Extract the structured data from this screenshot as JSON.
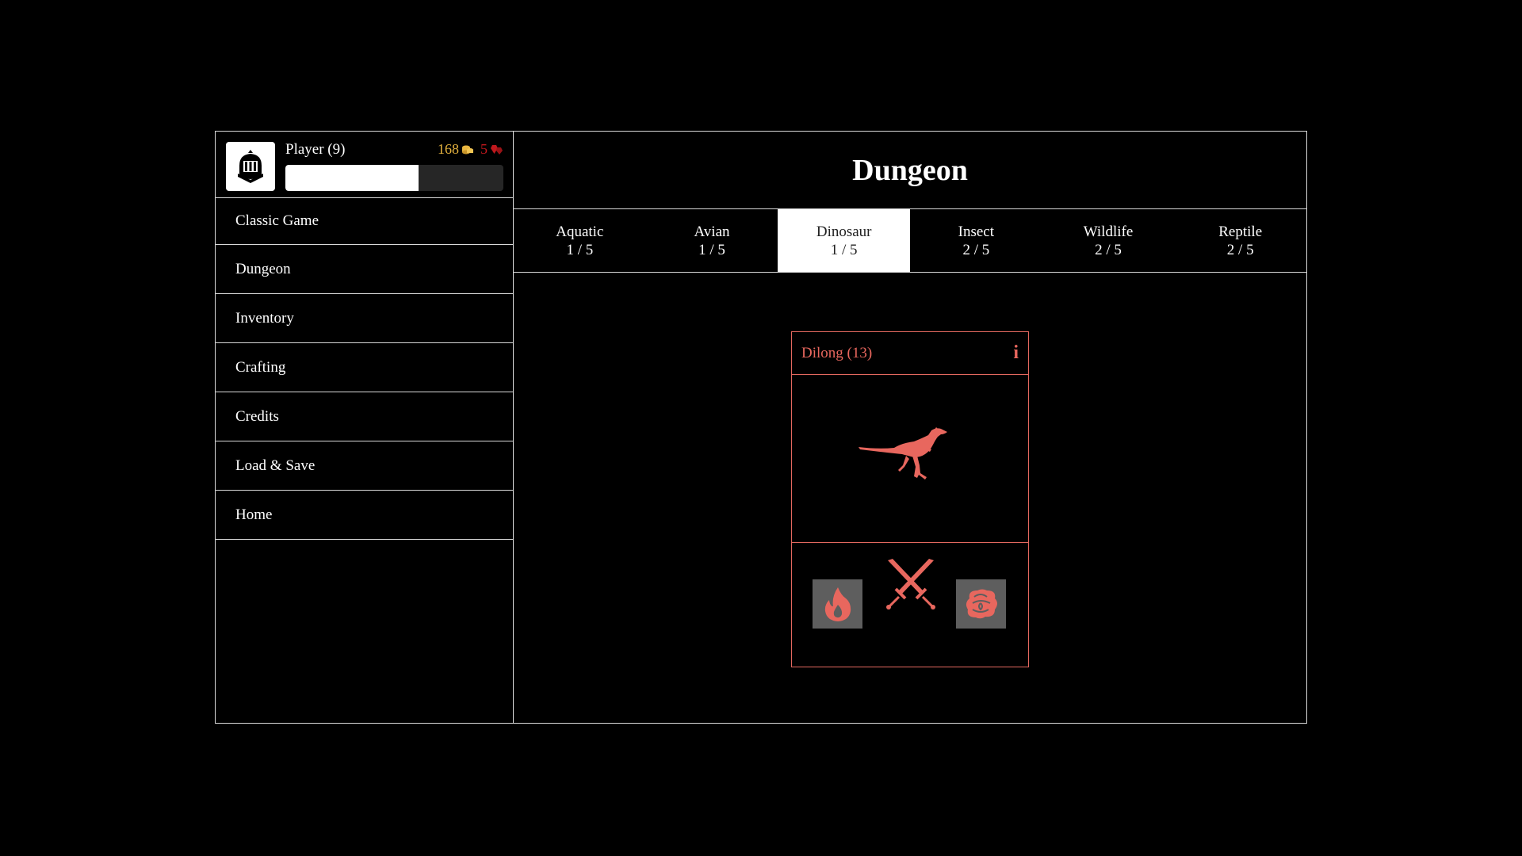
{
  "player": {
    "name": "Player (9)",
    "gold": "168",
    "gems": "5",
    "xp_fraction": 0.61,
    "icon": "knight-helmet-icon"
  },
  "nav": {
    "items": [
      {
        "label": "Classic Game"
      },
      {
        "label": "Dungeon"
      },
      {
        "label": "Inventory"
      },
      {
        "label": "Crafting"
      },
      {
        "label": "Credits"
      },
      {
        "label": "Load & Save"
      },
      {
        "label": "Home"
      }
    ]
  },
  "main": {
    "title": "Dungeon",
    "tabs": [
      {
        "label": "Aquatic",
        "progress": "1 / 5",
        "active": false
      },
      {
        "label": "Avian",
        "progress": "1 / 5",
        "active": false
      },
      {
        "label": "Dinosaur",
        "progress": "1 / 5",
        "active": true
      },
      {
        "label": "Insect",
        "progress": "2 / 5",
        "active": false
      },
      {
        "label": "Wildlife",
        "progress": "2 / 5",
        "active": false
      },
      {
        "label": "Reptile",
        "progress": "2 / 5",
        "active": false
      }
    ]
  },
  "card": {
    "name": "Dilong (13)",
    "info": "i",
    "creature_icon": "dinosaur-icon",
    "skills": [
      "fire-icon",
      "crossed-swords-icon",
      "brain-icon"
    ]
  },
  "colors": {
    "accent": "#e8675e",
    "gold": "#e8b53f",
    "gem": "#c0181d",
    "skill_bg": "#5e5e5e"
  }
}
